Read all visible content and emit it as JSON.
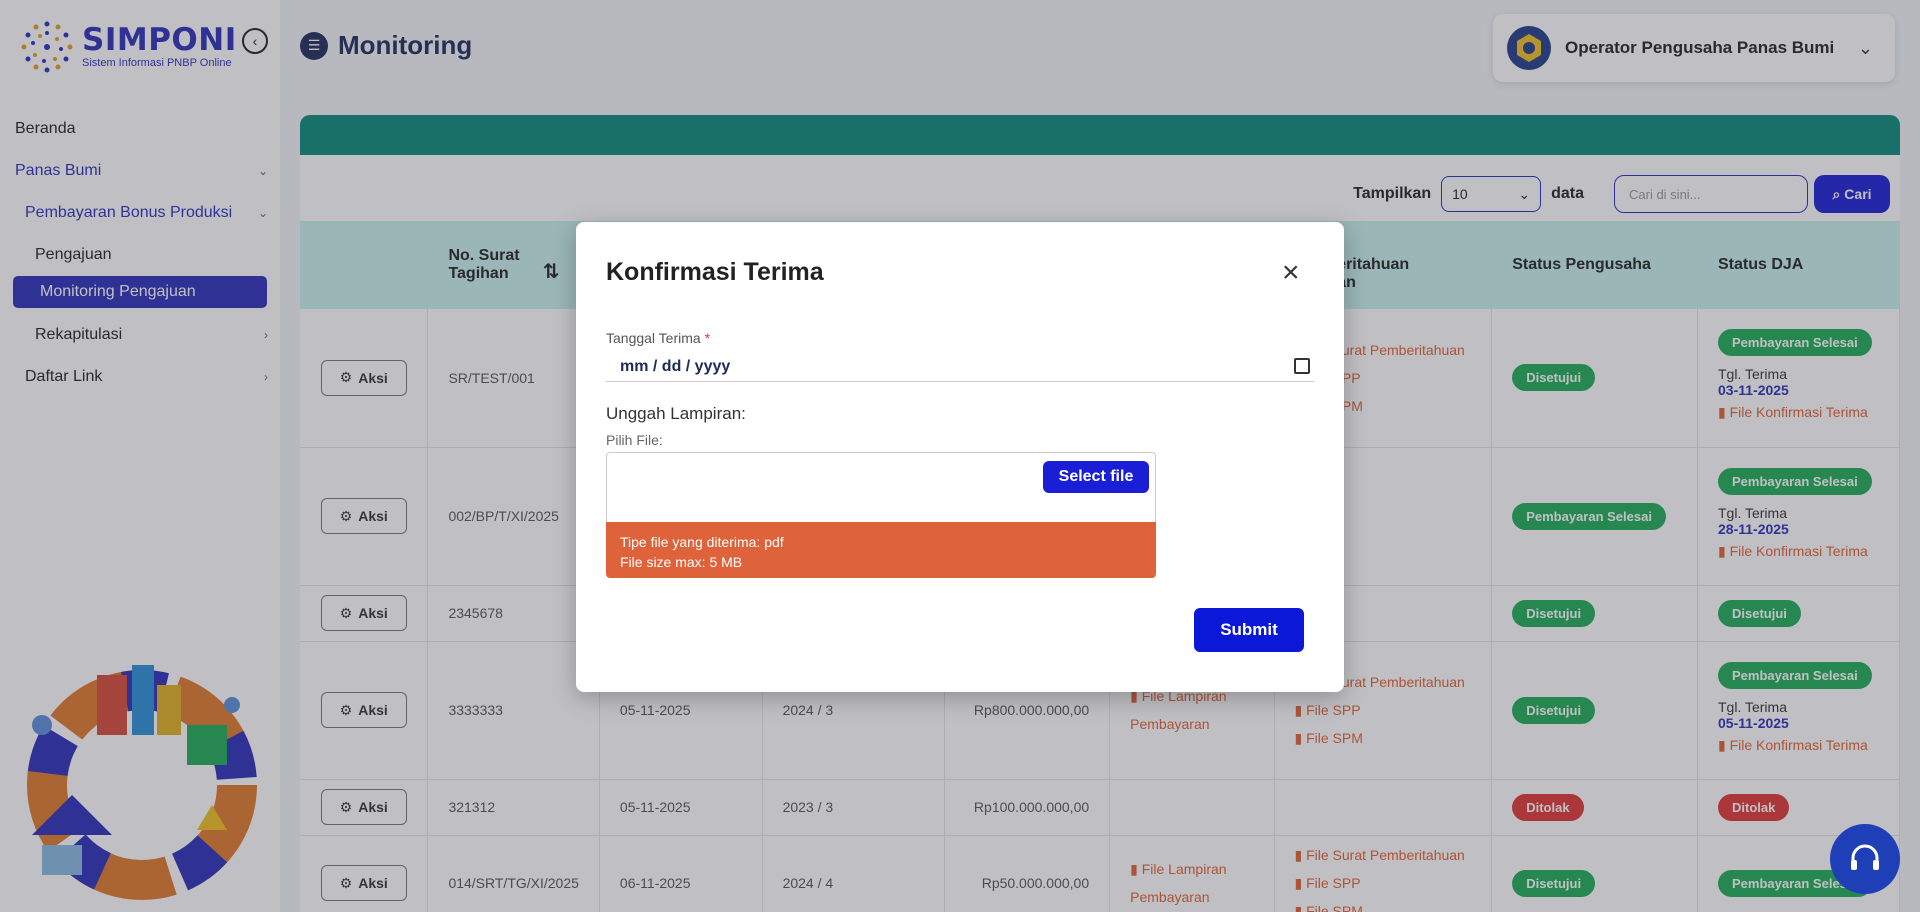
{
  "brand": {
    "name": "SIMPONI",
    "tagline": "Sistem Informasi PNBP Online"
  },
  "sidebar": {
    "items": [
      {
        "label": "Beranda"
      },
      {
        "label": "Panas Bumi"
      },
      {
        "label": "Pembayaran Bonus Produksi"
      },
      {
        "label": "Pengajuan"
      },
      {
        "label": "Monitoring Pengajuan"
      },
      {
        "label": "Rekapitulasi"
      },
      {
        "label": "Daftar Link"
      }
    ]
  },
  "header": {
    "title": "Monitoring",
    "user": "Operator Pengusaha Panas Bumi"
  },
  "toolbar": {
    "show_label": "Tampilkan",
    "page_size": "10",
    "data_label": "data",
    "search_placeholder": "Cari di sini...",
    "search_button": "Cari"
  },
  "table": {
    "headers": [
      "",
      "No. Surat Tagihan",
      "",
      "",
      "",
      "",
      "an\npemberitahuan\nbayaran",
      "Status Pengusaha",
      "Status DJA"
    ],
    "rows": [
      {
        "aksi": "Aksi",
        "no": "SR/TEST/001",
        "c3": "",
        "c4": "",
        "c5": "",
        "c6": "",
        "files": [
          "File Surat Pemberitahuan",
          "File SPP",
          "File SPM"
        ],
        "status_pengusaha": "Disetujui",
        "status_dja": "Pembayaran Selesai",
        "tgl_label": "Tgl. Terima",
        "tgl": "03-11-2025",
        "konfirmasi": "File Konfirmasi Terima"
      },
      {
        "aksi": "Aksi",
        "no": "002/BP/T/XI/2025",
        "c3": "",
        "c4": "",
        "c5": "",
        "c6": "",
        "files": [],
        "status_pengusaha": "Pembayaran Selesai",
        "status_dja": "Pembayaran Selesai",
        "tgl_label": "Tgl. Terima",
        "tgl": "28-11-2025",
        "konfirmasi": "File Konfirmasi Terima"
      },
      {
        "aksi": "Aksi",
        "no": "2345678",
        "c3": "",
        "c4": "",
        "c5": "",
        "c6": "",
        "files": [],
        "status_pengusaha": "Disetujui",
        "status_dja": "Disetujui",
        "tgl_label": "",
        "tgl": "",
        "konfirmasi": ""
      },
      {
        "aksi": "Aksi",
        "no": "3333333",
        "c3": "05-11-2025",
        "c4": "2024 / 3",
        "c5": "Rp800.000.000,00",
        "c6": "File Lampiran Pembayaran",
        "files": [
          "File Surat Pemberitahuan",
          "File SPP",
          "File SPM"
        ],
        "status_pengusaha": "Disetujui",
        "status_dja": "Pembayaran Selesai",
        "tgl_label": "Tgl. Terima",
        "tgl": "05-11-2025",
        "konfirmasi": "File Konfirmasi Terima"
      },
      {
        "aksi": "Aksi",
        "no": "321312",
        "c3": "05-11-2025",
        "c4": "2023 / 3",
        "c5": "Rp100.000.000,00",
        "c6": "",
        "files": [],
        "status_pengusaha": "Ditolak",
        "status_dja": "Ditolak",
        "tgl_label": "",
        "tgl": "",
        "konfirmasi": ""
      },
      {
        "aksi": "Aksi",
        "no": "014/SRT/TG/XI/2025",
        "c3": "06-11-2025",
        "c4": "2024 / 4",
        "c5": "Rp50.000.000,00",
        "c6": "File Lampiran Pembayaran",
        "files": [
          "File Surat Pemberitahuan",
          "File SPP",
          "File SPM"
        ],
        "status_pengusaha": "Disetujui",
        "status_dja": "Pembayaran Selesai",
        "tgl_label": "",
        "tgl": "",
        "konfirmasi": ""
      }
    ]
  },
  "modal": {
    "title": "Konfirmasi Terima",
    "date_label": "Tanggal Terima",
    "date_required_mark": "*",
    "date_placeholder": "mm / dd / yyyy",
    "upload_title": "Unggah Lampiran:",
    "choose_label": "Pilih File:",
    "select_button": "Select file",
    "file_type_text": "Tipe file yang diterima: pdf",
    "file_size_text": "File size max: 5 MB",
    "submit_label": "Submit"
  },
  "colors": {
    "brand_blue": "#2a2eb8",
    "primary_button": "#1a1fd6",
    "teal": "#0a8a78",
    "table_header": "#c7f0ec",
    "success": "#1eac55",
    "danger": "#e03535",
    "file_warning": "#de623a"
  }
}
